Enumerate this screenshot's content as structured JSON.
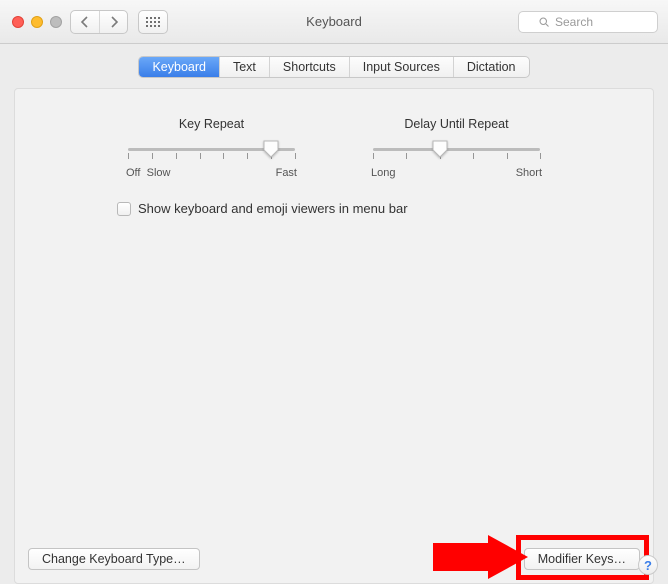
{
  "window": {
    "title": "Keyboard"
  },
  "search": {
    "placeholder": "Search"
  },
  "tabs": {
    "items": [
      "Keyboard",
      "Text",
      "Shortcuts",
      "Input Sources",
      "Dictation"
    ],
    "selected_index": 0
  },
  "sliders": {
    "key_repeat": {
      "title": "Key Repeat",
      "left_label": "Off",
      "left_label2": "Slow",
      "right_label": "Fast",
      "tick_count": 8,
      "value_index": 6
    },
    "delay": {
      "title": "Delay Until Repeat",
      "left_label": "Long",
      "right_label": "Short",
      "tick_count": 6,
      "value_index": 2
    }
  },
  "checkbox": {
    "label": "Show keyboard and emoji viewers in menu bar",
    "checked": false
  },
  "buttons": {
    "change_type": "Change Keyboard Type…",
    "modifier": "Modifier Keys…"
  },
  "help_glyph": "?",
  "annotation": {
    "color": "#ff0000"
  }
}
